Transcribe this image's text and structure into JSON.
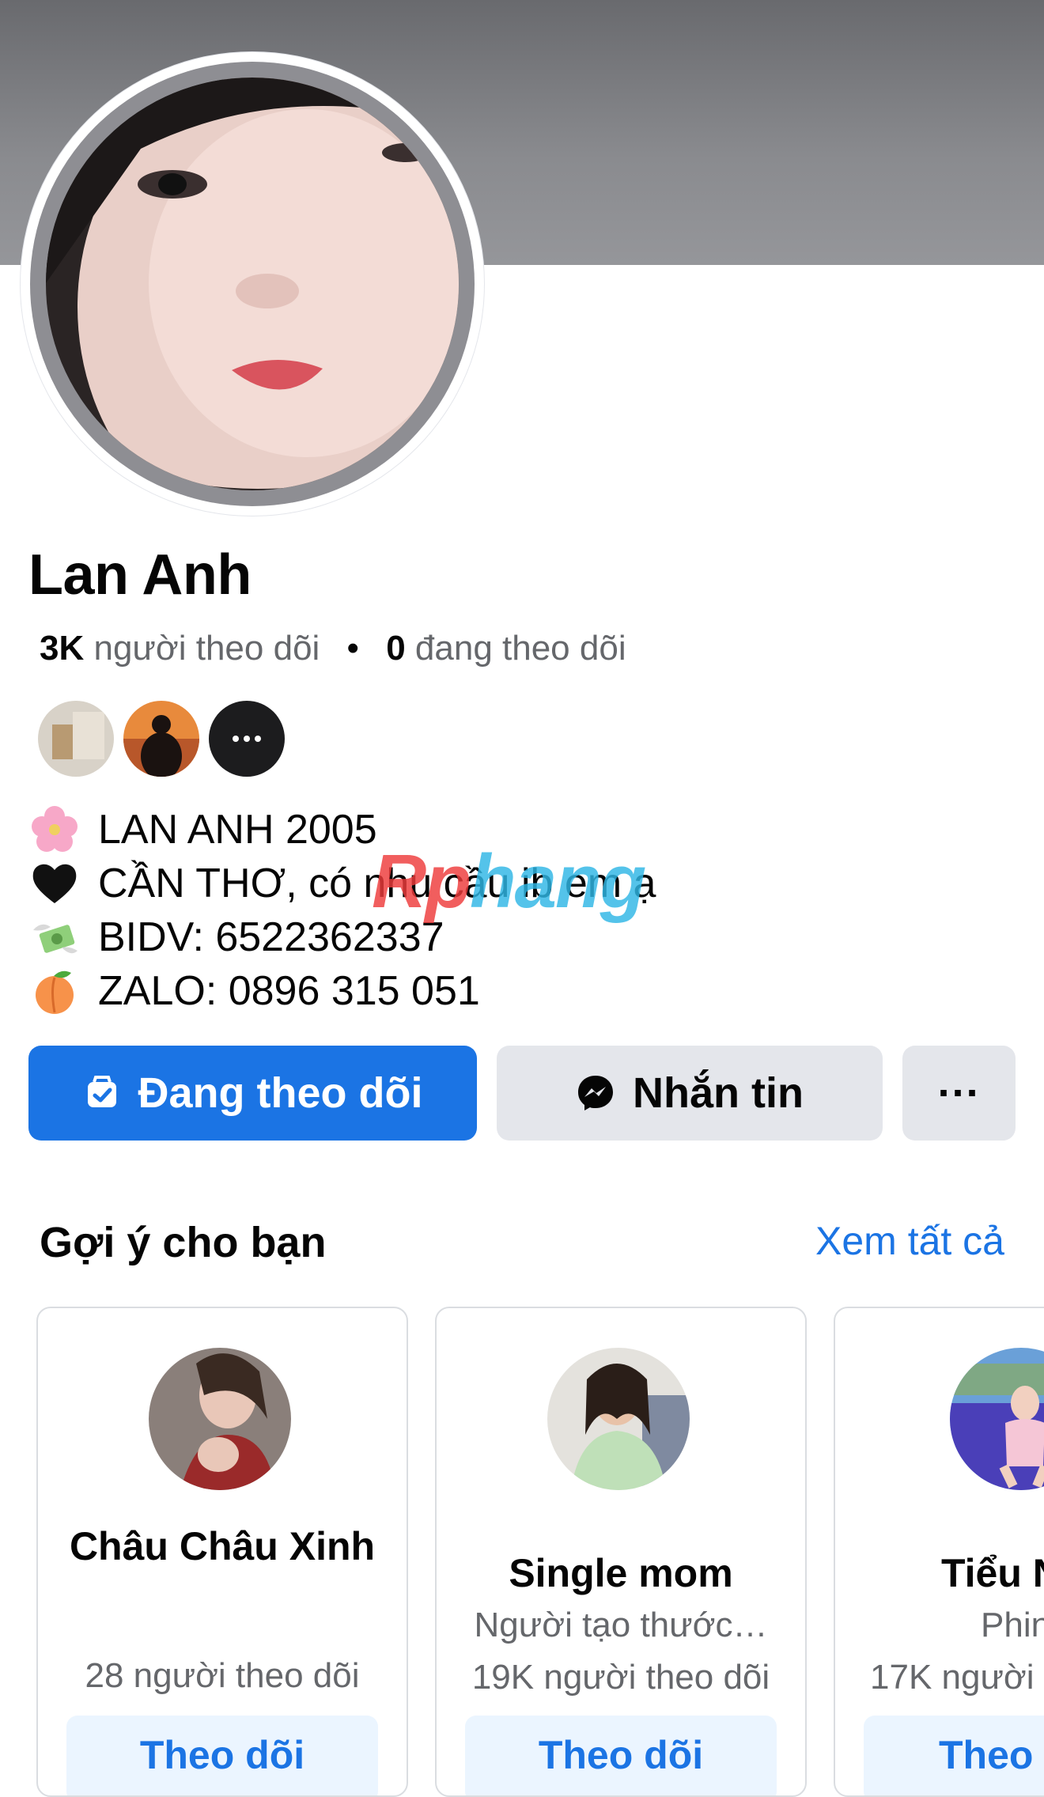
{
  "profile": {
    "name": "Lan Anh",
    "followers_count": "3K",
    "followers_label": "người theo dõi",
    "following_count": "0",
    "following_label": "đang theo dõi"
  },
  "bio": {
    "lines": [
      {
        "icon": "cherry-blossom-icon",
        "text": "LAN ANH 2005"
      },
      {
        "icon": "black-heart-icon",
        "text": "CẦN THƠ, có nhu cầu ib em ạ"
      },
      {
        "icon": "money-wings-icon",
        "text": "BIDV: 6522362337"
      },
      {
        "icon": "peach-icon",
        "text": "ZALO: 0896 315 051"
      }
    ]
  },
  "watermark": {
    "part1": "Rp",
    "part2": "hang"
  },
  "actions": {
    "following_label": "Đang theo dõi",
    "message_label": "Nhắn tin",
    "more_label": "···"
  },
  "suggestions": {
    "title": "Gợi ý cho bạn",
    "see_all": "Xem tất cả",
    "cards": [
      {
        "name": "Châu Châu Xinh",
        "subtitle": "",
        "followers": "28 người theo dõi",
        "button": "Theo dõi"
      },
      {
        "name": "Single mom",
        "subtitle": "Người tạo thước…",
        "followers": "19K người theo dõi",
        "button": "Theo dõi"
      },
      {
        "name": "Tiểu N",
        "subtitle": "Phin",
        "followers": "17K người t",
        "button": "Theo"
      }
    ]
  },
  "colors": {
    "accent": "#1b74e4",
    "secondary_button": "#e4e6eb",
    "muted_text": "#65676b"
  }
}
